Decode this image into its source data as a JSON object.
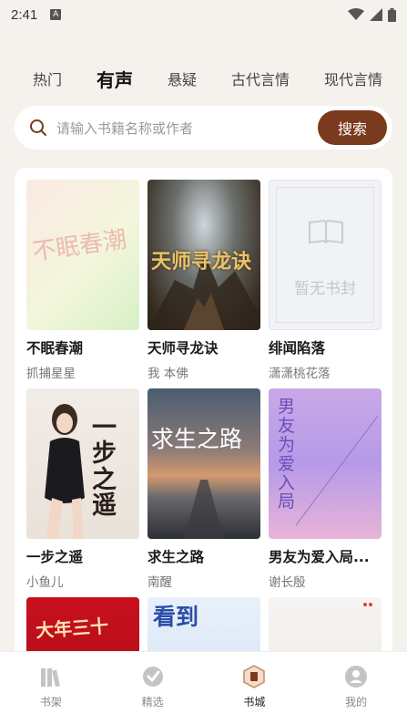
{
  "status": {
    "time": "2:41",
    "notif_letter": "A"
  },
  "tabs": [
    {
      "label": "热门"
    },
    {
      "label": "有声"
    },
    {
      "label": "悬疑"
    },
    {
      "label": "古代言情"
    },
    {
      "label": "现代言情"
    }
  ],
  "search": {
    "placeholder": "请输入书籍名称或作者",
    "button": "搜索"
  },
  "books": [
    {
      "title": "不眠春潮",
      "author": "抓捕星星",
      "cover_text": "不眠春潮"
    },
    {
      "title": "天师寻龙诀",
      "author": "我 本佛",
      "cover_text": "天师寻龙诀"
    },
    {
      "title": "绯闻陷落",
      "author": "潇潇桃花落",
      "cover_text": "暂无书封"
    },
    {
      "title": "一步之遥",
      "author": "小鱼儿",
      "cover_text": "一步之遥"
    },
    {
      "title": "求生之路",
      "author": "南醒",
      "cover_text": "求生之路"
    },
    {
      "title": "男友为爱入局...",
      "author": "谢长殷",
      "cover_text": "男友为爱入局"
    },
    {
      "title": "",
      "author": "",
      "cover_text": "大年三十"
    },
    {
      "title": "",
      "author": "",
      "cover_text": "看到"
    },
    {
      "title": "",
      "author": "",
      "cover_text": ""
    }
  ],
  "nav": [
    {
      "label": "书架",
      "icon": "bookshelf-icon"
    },
    {
      "label": "精选",
      "icon": "featured-icon"
    },
    {
      "label": "书城",
      "icon": "bookstore-icon"
    },
    {
      "label": "我的",
      "icon": "profile-icon"
    }
  ],
  "colors": {
    "accent": "#7a3a1e",
    "background": "#f5f1ec"
  }
}
